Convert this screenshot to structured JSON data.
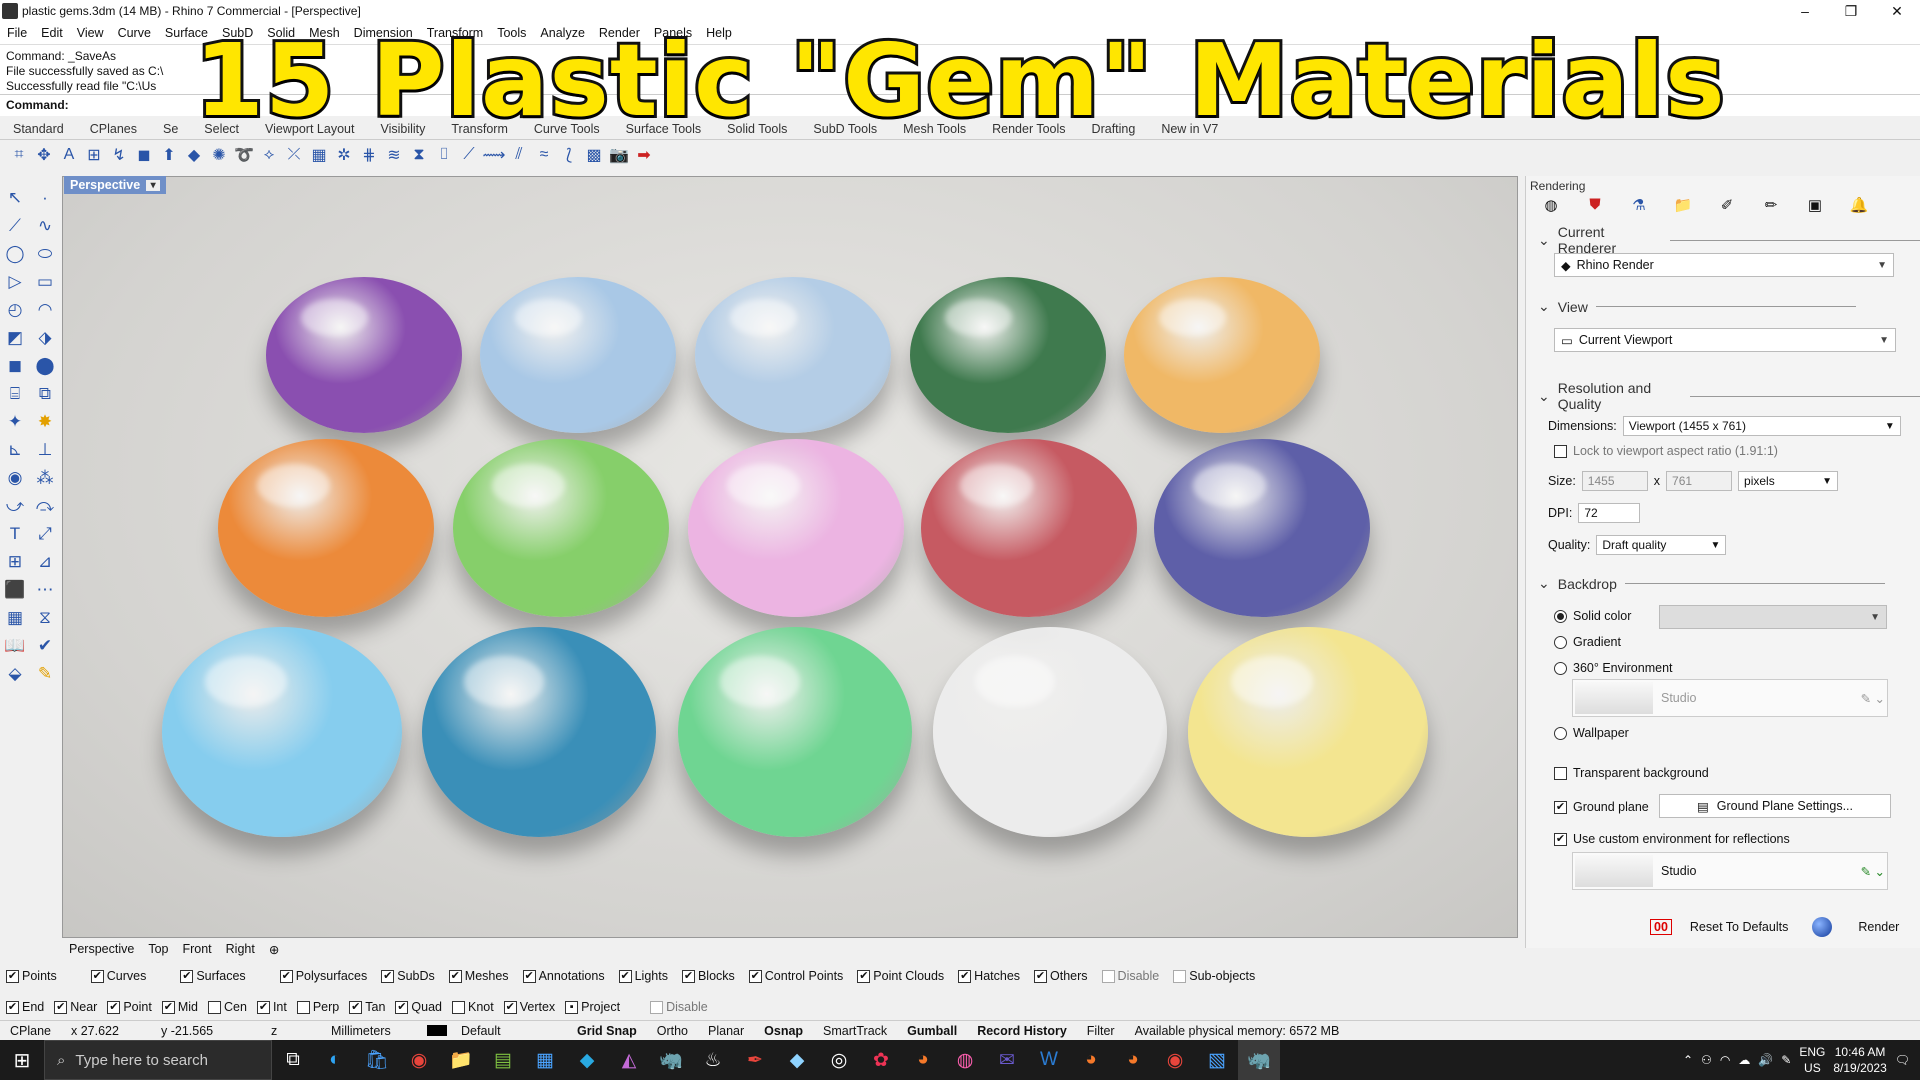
{
  "titlebar": {
    "text": "plastic gems.3dm (14 MB) - Rhino 7 Commercial - [Perspective]"
  },
  "menu": [
    "File",
    "Edit",
    "View",
    "Curve",
    "Surface",
    "SubD",
    "Solid",
    "Mesh",
    "Dimension",
    "Transform",
    "Tools",
    "Analyze",
    "Render",
    "Panels",
    "Help"
  ],
  "command": {
    "lines": [
      "Command: _SaveAs",
      "File successfully saved as C:\\",
      "Successfully read file \"C:\\Us"
    ],
    "prompt": "Command:"
  },
  "toolbar_tabs": [
    "Standard",
    "CPlanes",
    "Se",
    "Select",
    "Viewport Layout",
    "Visibility",
    "Transform",
    "Curve Tools",
    "Surface Tools",
    "Solid Tools",
    "SubD Tools",
    "Mesh Tools",
    "Render Tools",
    "Drafting",
    "New in V7"
  ],
  "viewport": {
    "label": "Perspective"
  },
  "gems": [
    {
      "color": "#8a4fb0"
    },
    {
      "color": "#a9c8e6"
    },
    {
      "color": "#b4cde6"
    },
    {
      "color": "#3f7a4e"
    },
    {
      "color": "#f0b866"
    },
    {
      "color": "#ec8a3a"
    },
    {
      "color": "#86cf6a"
    },
    {
      "color": "#ecb4e2"
    },
    {
      "color": "#c65a62"
    },
    {
      "color": "#5e5fa8"
    },
    {
      "color": "#86cdee"
    },
    {
      "color": "#3a8fb8"
    },
    {
      "color": "#6fd592"
    },
    {
      "color": "#ececec"
    },
    {
      "color": "#f3e590"
    }
  ],
  "viewport_tabs": [
    "Perspective",
    "Top",
    "Front",
    "Right"
  ],
  "panel": {
    "title": "Rendering",
    "current_renderer_heading": "Current Renderer",
    "renderer": "Rhino Render",
    "view_heading": "View",
    "view_value": "Current Viewport",
    "resolution_heading": "Resolution and Quality",
    "dimensions_label": "Dimensions:",
    "dimensions_value": "Viewport (1455 x 761)",
    "lock_label": "Lock to viewport aspect ratio (1.91:1)",
    "size_label": "Size:",
    "size_w": "1455",
    "size_x": "x",
    "size_h": "761",
    "units": "pixels",
    "dpi_label": "DPI:",
    "dpi": "72",
    "quality_label": "Quality:",
    "quality": "Draft quality",
    "backdrop_heading": "Backdrop",
    "solid_color": "Solid color",
    "gradient": "Gradient",
    "env360": "360° Environment",
    "env_name": "Studio",
    "wallpaper": "Wallpaper",
    "transparent_bg": "Transparent background",
    "ground_plane": "Ground plane",
    "ground_plane_btn": "Ground Plane Settings...",
    "custom_env": "Use custom environment for reflections",
    "custom_env_name": "Studio",
    "reset": "Reset To Defaults",
    "render": "Render"
  },
  "filters": {
    "row1": [
      {
        "label": "Points",
        "checked": true
      },
      {
        "label": "Curves",
        "checked": true
      },
      {
        "label": "Surfaces",
        "checked": true
      },
      {
        "label": "Polysurfaces",
        "checked": true
      },
      {
        "label": "SubDs",
        "checked": true
      },
      {
        "label": "Meshes",
        "checked": true
      },
      {
        "label": "Annotations",
        "checked": true
      },
      {
        "label": "Lights",
        "checked": true
      },
      {
        "label": "Blocks",
        "checked": true
      },
      {
        "label": "Control Points",
        "checked": true
      },
      {
        "label": "Point Clouds",
        "checked": true
      },
      {
        "label": "Hatches",
        "checked": true
      },
      {
        "label": "Others",
        "checked": true
      },
      {
        "label": "Disable",
        "checked": false
      },
      {
        "label": "Sub-objects",
        "checked": false
      }
    ],
    "row2": [
      {
        "label": "End",
        "checked": true
      },
      {
        "label": "Near",
        "checked": true
      },
      {
        "label": "Point",
        "checked": true
      },
      {
        "label": "Mid",
        "checked": true
      },
      {
        "label": "Cen",
        "checked": false
      },
      {
        "label": "Int",
        "checked": true
      },
      {
        "label": "Perp",
        "checked": false
      },
      {
        "label": "Tan",
        "checked": true
      },
      {
        "label": "Quad",
        "checked": true
      },
      {
        "label": "Knot",
        "checked": false
      },
      {
        "label": "Vertex",
        "checked": true
      },
      {
        "label": "Project",
        "checked": false
      },
      {
        "label": "Disable",
        "checked": false
      }
    ]
  },
  "status": {
    "cplane": "CPlane",
    "x": "x 27.622",
    "y": "y -21.565",
    "z": "z",
    "units": "Millimeters",
    "layer": "Default",
    "grid_snap": "Grid Snap",
    "ortho": "Ortho",
    "planar": "Planar",
    "osnap": "Osnap",
    "smarttrack": "SmartTrack",
    "gumball": "Gumball",
    "record_history": "Record History",
    "filter": "Filter",
    "memory": "Available physical memory: 6572 MB"
  },
  "taskbar": {
    "search_placeholder": "Type here to search",
    "lang": "ENG",
    "region": "US",
    "time": "10:46 AM",
    "date": "8/19/2023"
  },
  "overlay_title": "15 Plastic \"Gem\" Materials",
  "colors": {
    "accent": "#6f8fc8",
    "overlay_text": "#ffe600"
  }
}
